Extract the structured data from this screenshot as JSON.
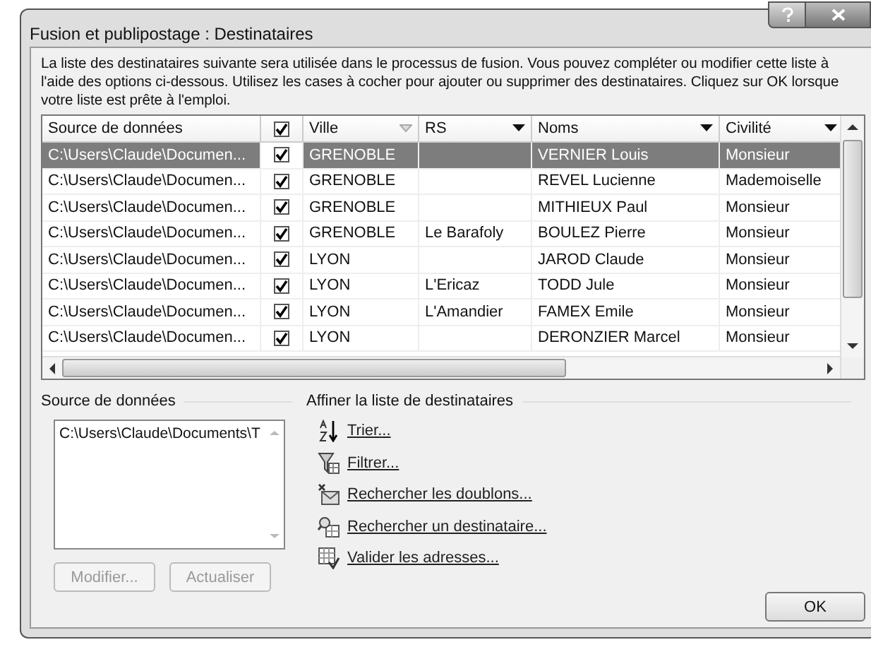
{
  "window": {
    "title": "Fusion et publipostage : Destinataires"
  },
  "description": "La liste des destinataires suivante sera utilisée dans le processus de fusion. Vous pouvez compléter ou modifier cette liste à l'aide des options ci-dessous. Utilisez les cases à cocher pour ajouter ou supprimer des destinataires. Cliquez sur OK lorsque votre liste est prête à l'emploi.",
  "table": {
    "header_checked": true,
    "columns": [
      {
        "label": "Source de données"
      },
      {
        "label": "Ville",
        "filter_active": false
      },
      {
        "label": "RS",
        "filter_active": true
      },
      {
        "label": "Noms",
        "filter_active": true
      },
      {
        "label": "Civilité",
        "filter_active": true
      }
    ],
    "rows": [
      {
        "selected": true,
        "checked": true,
        "cells": [
          "C:\\Users\\Claude\\Documen...",
          "GRENOBLE",
          "",
          "VERNIER Louis",
          "Monsieur"
        ]
      },
      {
        "selected": false,
        "checked": true,
        "cells": [
          "C:\\Users\\Claude\\Documen...",
          "GRENOBLE",
          "",
          "REVEL Lucienne",
          "Mademoiselle"
        ]
      },
      {
        "selected": false,
        "checked": true,
        "cells": [
          "C:\\Users\\Claude\\Documen...",
          "GRENOBLE",
          "",
          "MITHIEUX Paul",
          "Monsieur"
        ]
      },
      {
        "selected": false,
        "checked": true,
        "cells": [
          "C:\\Users\\Claude\\Documen...",
          "GRENOBLE",
          "Le Barafoly",
          "BOULEZ Pierre",
          "Monsieur"
        ]
      },
      {
        "selected": false,
        "checked": true,
        "cells": [
          "C:\\Users\\Claude\\Documen...",
          "LYON",
          "",
          "JAROD Claude",
          "Monsieur"
        ]
      },
      {
        "selected": false,
        "checked": true,
        "cells": [
          "C:\\Users\\Claude\\Documen...",
          "LYON",
          "L'Ericaz",
          "TODD Jule",
          "Monsieur"
        ]
      },
      {
        "selected": false,
        "checked": true,
        "cells": [
          "C:\\Users\\Claude\\Documen...",
          "LYON",
          "L'Amandier",
          "FAMEX Emile",
          "Monsieur"
        ]
      },
      {
        "selected": false,
        "checked": true,
        "cells": [
          "C:\\Users\\Claude\\Documen...",
          "LYON",
          "",
          "DERONZIER Marcel",
          "Monsieur"
        ]
      }
    ]
  },
  "data_source": {
    "label": "Source de données",
    "items": [
      "C:\\Users\\Claude\\Documents\\T"
    ],
    "buttons": [
      {
        "label": "Modifier...",
        "disabled": true
      },
      {
        "label": "Actualiser",
        "disabled": true
      }
    ]
  },
  "refine": {
    "label": "Affiner la liste de destinataires",
    "links": [
      {
        "label": "Trier...",
        "kind": "sort"
      },
      {
        "label": "Filtrer...",
        "kind": "filter"
      },
      {
        "label": "Rechercher les doublons...",
        "kind": "duplicates"
      },
      {
        "label": "Rechercher un destinataire...",
        "kind": "find"
      },
      {
        "label": "Valider les adresses...",
        "kind": "validate"
      }
    ]
  },
  "ok_button": "OK"
}
